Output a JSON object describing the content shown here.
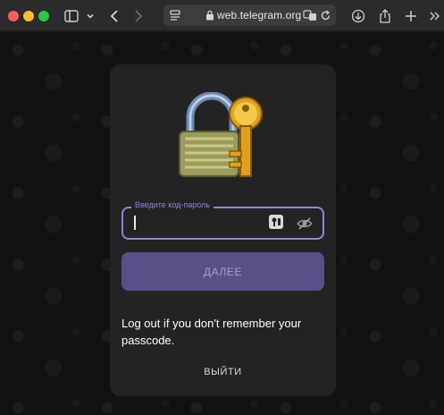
{
  "browser": {
    "url": "web.telegram.org"
  },
  "passcode": {
    "placeholder_label": "Введите код-пароль",
    "value": "",
    "next_label": "ДАЛЕЕ",
    "hint": "Log out if you don't remember your passcode.",
    "logout_label": "ВЫЙТИ"
  },
  "colors": {
    "accent": "#8f84d9",
    "button_bg": "#5b4f8a",
    "card_bg": "#232323"
  }
}
